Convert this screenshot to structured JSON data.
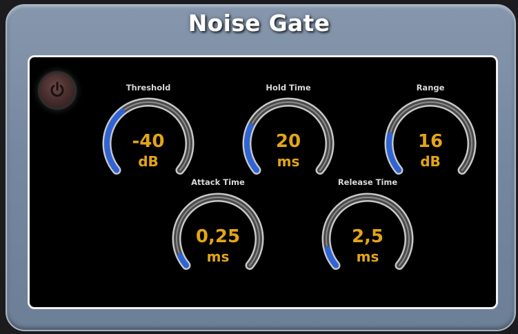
{
  "title": "Noise Gate",
  "power": {
    "icon": "power-icon",
    "state": "off",
    "color": "#6a4646"
  },
  "colors": {
    "accent": "#2f64d6",
    "value_text": "#e3a516",
    "track": "#9a9a9a"
  },
  "knobs": [
    {
      "id": "threshold",
      "label": "Threshold",
      "value": "-40",
      "unit": "dB",
      "level": 0.35
    },
    {
      "id": "hold",
      "label": "Hold Time",
      "value": "20",
      "unit": "ms",
      "level": 0.25
    },
    {
      "id": "range",
      "label": "Range",
      "value": "16",
      "unit": "dB",
      "level": 0.2
    },
    {
      "id": "attack",
      "label": "Attack Time",
      "value": "0,25",
      "unit": "ms",
      "level": 0.06
    },
    {
      "id": "release",
      "label": "Release Time",
      "value": "2,5",
      "unit": "ms",
      "level": 0.1
    }
  ]
}
